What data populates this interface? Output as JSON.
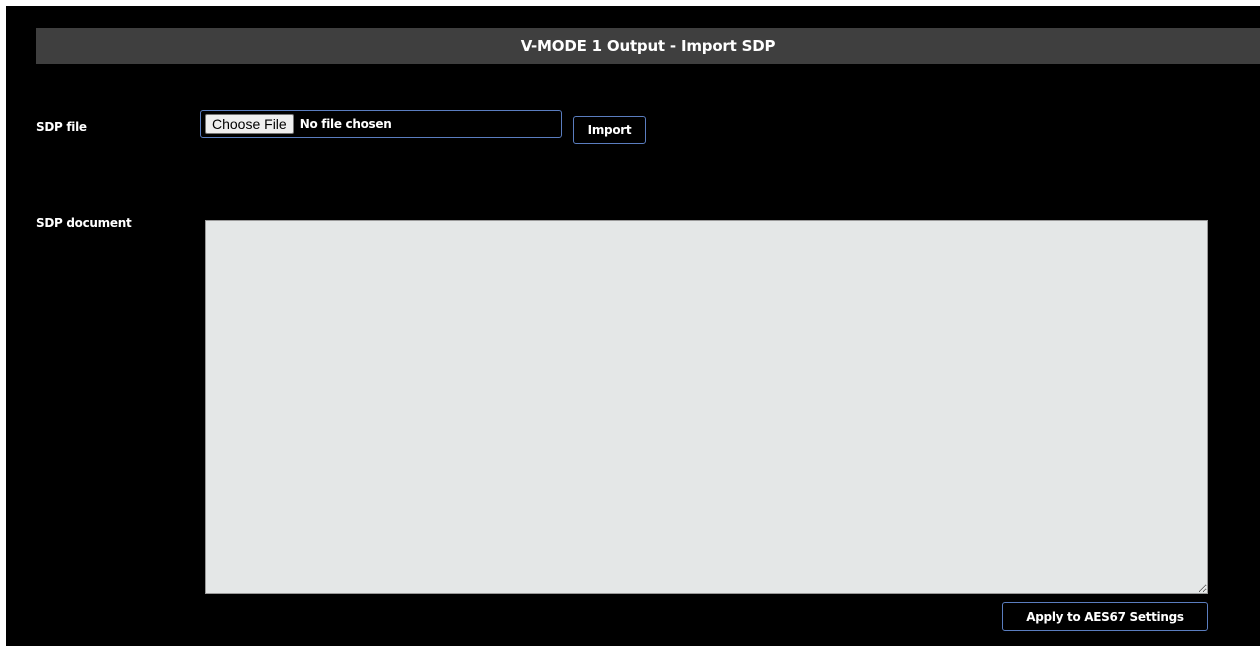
{
  "header": {
    "title": "V-MODE  1 Output - Import SDP"
  },
  "sdp_file": {
    "label": "SDP file",
    "choose_label": "Choose File",
    "status": "No file chosen",
    "import_label": "Import"
  },
  "sdp_document": {
    "label": "SDP document",
    "value": ""
  },
  "actions": {
    "apply_label": "Apply to AES67 Settings"
  },
  "colors": {
    "background": "#000000",
    "title_bar": "#3f3f3f",
    "accent_border": "#5a7dbf",
    "textarea_bg": "#e4e7e7"
  }
}
